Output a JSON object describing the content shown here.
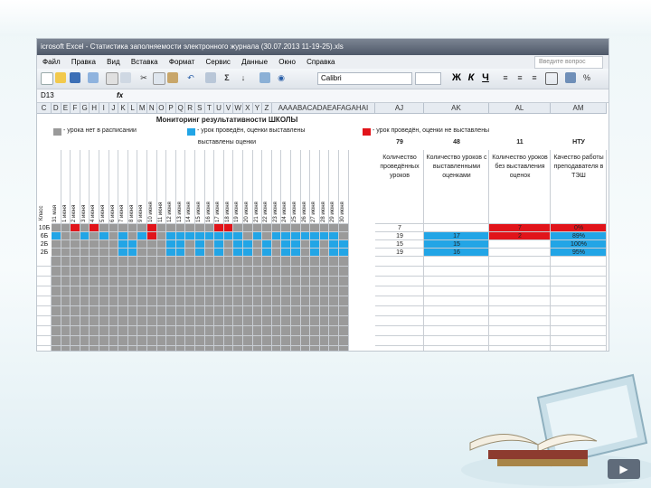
{
  "window": {
    "title": "icrosoft Excel - Статистика заполняемости электронного журнала (30.07.2013 11-19-25).xls"
  },
  "menu": {
    "items": [
      "Файл",
      "Правка",
      "Вид",
      "Вставка",
      "Формат",
      "Сервис",
      "Данные",
      "Окно",
      "Справка"
    ],
    "help_placeholder": "Введите вопрос"
  },
  "toolbar": {
    "font_name": "Calibri",
    "font_size": "",
    "bold_label": "Ж",
    "italic_label": "К",
    "underline_label": "Ч"
  },
  "formula_bar": {
    "name_box": "D13",
    "fx_label": "fx"
  },
  "columns": [
    "C",
    "D",
    "E",
    "F",
    "G",
    "H",
    "I",
    "J",
    "K",
    "L",
    "M",
    "N",
    "O",
    "P",
    "Q",
    "R",
    "S",
    "T",
    "U",
    "V",
    "W",
    "X",
    "Y",
    "Z",
    "AAAABACADAEAFAGAHAI",
    "AJ",
    "AK",
    "AL",
    "AM"
  ],
  "sheet": {
    "heading": "Мониторинг результативности ШКОЛЫ",
    "legend": [
      {
        "color": "#9a9a9a",
        "label": "- урока нет в расписании"
      },
      {
        "color": "#22a5e6",
        "label": "- урок проведён, оценки выставлены"
      },
      {
        "color": "#e1141a",
        "label": "- урок проведён, оценки не выставлены"
      }
    ],
    "period_label": "выставлены оценки",
    "class_header": "Класс",
    "day_headers": [
      "31 мая",
      "1 июня",
      "2 июня",
      "3 июня",
      "4 июня",
      "5 июня",
      "6 июня",
      "7 июня",
      "8 июня",
      "9 июня",
      "10 июня",
      "11 июня",
      "12 июня",
      "13 июня",
      "14 июня",
      "15 июня",
      "16 июня",
      "17 июня",
      "18 июня",
      "19 июня",
      "20 июня",
      "21 июня",
      "22 июня",
      "23 июня",
      "24 июня",
      "25 июня",
      "26 июня",
      "27 июня",
      "28 июня",
      "29 июня",
      "30 июня"
    ],
    "totals": {
      "total": "79",
      "with_marks": "48",
      "without_marks": "11",
      "quality": "НТУ"
    },
    "stat_headers": [
      "Количество проведённых уроков",
      "Количество уроков с выставленными оценками",
      "Количество уроков без выставления оценок",
      "Качество работы преподавателя в ТЭШ"
    ],
    "rows": [
      {
        "class": "10Б",
        "total": "7",
        "with": "",
        "without": "7",
        "pct": "0%",
        "state": "red"
      },
      {
        "class": "6Б",
        "total": "19",
        "with": "17",
        "without": "2",
        "pct": "89%",
        "state": "blue"
      },
      {
        "class": "2Б",
        "total": "15",
        "with": "15",
        "without": "",
        "pct": "100%",
        "state": "blue"
      },
      {
        "class": "2Б",
        "total": "19",
        "with": "16",
        "without": "",
        "pct": "95%",
        "state": "blue"
      }
    ],
    "grid_pattern": [
      [
        "G",
        "G",
        "R",
        "G",
        "R",
        "G",
        "G",
        "G",
        "G",
        "G",
        "R",
        "G",
        "G",
        "G",
        "G",
        "G",
        "G",
        "R",
        "R",
        "G",
        "G",
        "G",
        "G",
        "G",
        "G",
        "G",
        "G",
        "G",
        "G",
        "G",
        "G"
      ],
      [
        "B",
        "G",
        "G",
        "B",
        "G",
        "B",
        "G",
        "B",
        "G",
        "B",
        "R",
        "G",
        "B",
        "B",
        "B",
        "B",
        "B",
        "B",
        "B",
        "B",
        "G",
        "B",
        "G",
        "B",
        "B",
        "B",
        "B",
        "B",
        "B",
        "B",
        "G"
      ],
      [
        "G",
        "G",
        "G",
        "G",
        "G",
        "G",
        "G",
        "B",
        "B",
        "G",
        "G",
        "G",
        "B",
        "B",
        "G",
        "B",
        "G",
        "B",
        "G",
        "B",
        "B",
        "G",
        "B",
        "G",
        "B",
        "B",
        "G",
        "B",
        "G",
        "B",
        "B"
      ],
      [
        "G",
        "G",
        "G",
        "G",
        "G",
        "G",
        "G",
        "B",
        "B",
        "G",
        "G",
        "G",
        "B",
        "B",
        "G",
        "B",
        "G",
        "B",
        "G",
        "B",
        "B",
        "G",
        "B",
        "G",
        "B",
        "B",
        "G",
        "B",
        "G",
        "B",
        "B"
      ]
    ]
  },
  "colors": {
    "gray": "#9a9a9a",
    "blue": "#22a5e6",
    "red": "#e1141a"
  }
}
